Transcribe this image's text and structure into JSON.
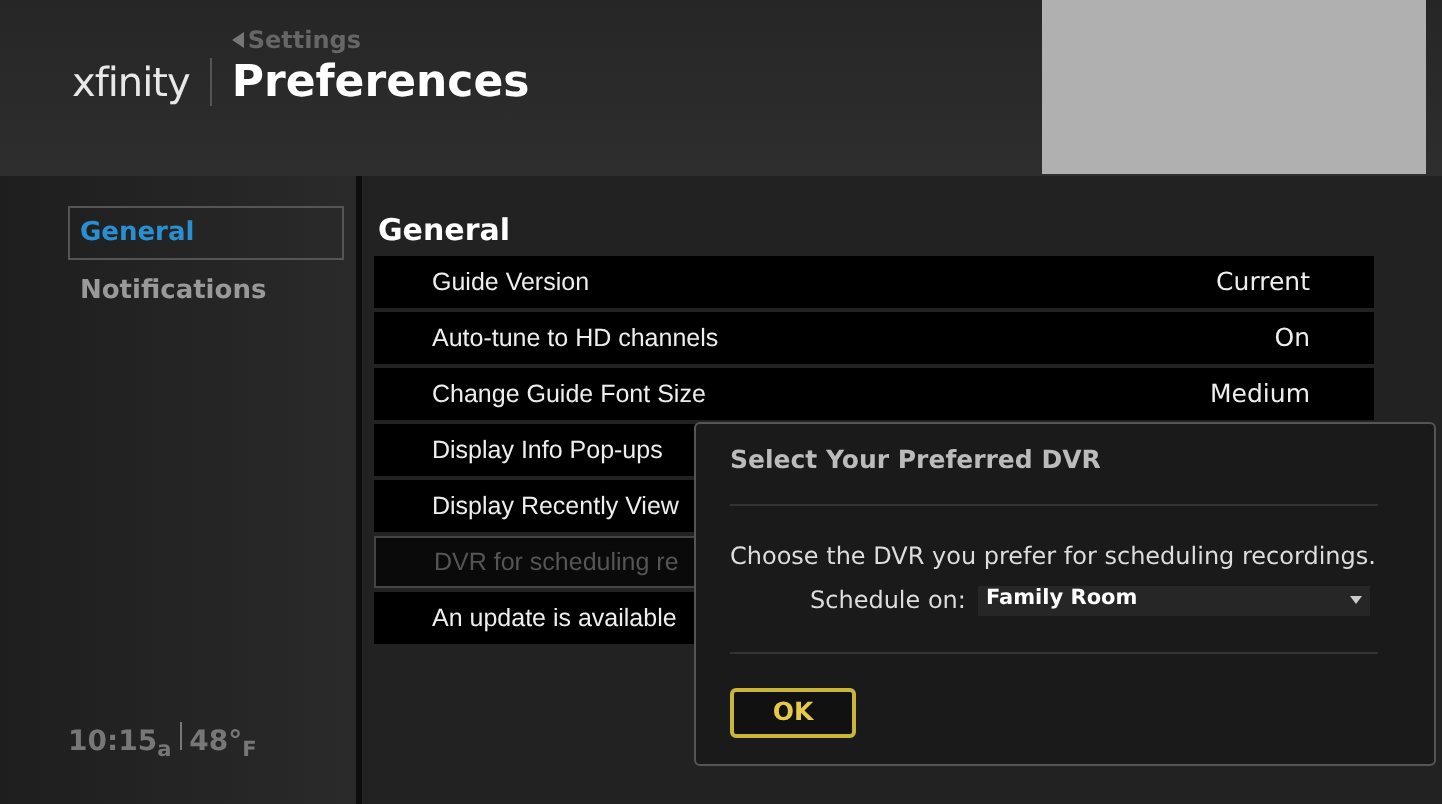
{
  "header": {
    "logo": "xfinity",
    "back": "Settings",
    "title": "Preferences"
  },
  "sidebar": {
    "items": [
      {
        "label": "General",
        "selected": true
      },
      {
        "label": "Notifications",
        "selected": false
      }
    ]
  },
  "status": {
    "time": "10:15$_{a}$",
    "weather": "48°$_{F}$"
  },
  "section": {
    "title": "General",
    "rows": [
      {
        "label": "Guide Version",
        "value": "Current",
        "disabled": false
      },
      {
        "label": "Auto-tune to HD channels",
        "value": "On",
        "disabled": false
      },
      {
        "label": "Change Guide Font Size",
        "value": "Medium",
        "disabled": false
      },
      {
        "label": "Display Info Pop-ups",
        "disabled": false
      },
      {
        "label": "Display Recently View",
        "disabled": false
      },
      {
        "label": "DVR for scheduling re",
        "disabled": true
      },
      {
        "label": "An update is available",
        "disabled": false
      }
    ]
  },
  "dialog": {
    "title": "Select Your Preferred DVR",
    "message": "Choose the DVR you prefer for scheduling recordings.",
    "field_label": "Schedule on:",
    "value": "Family Room",
    "button": "OK"
  }
}
